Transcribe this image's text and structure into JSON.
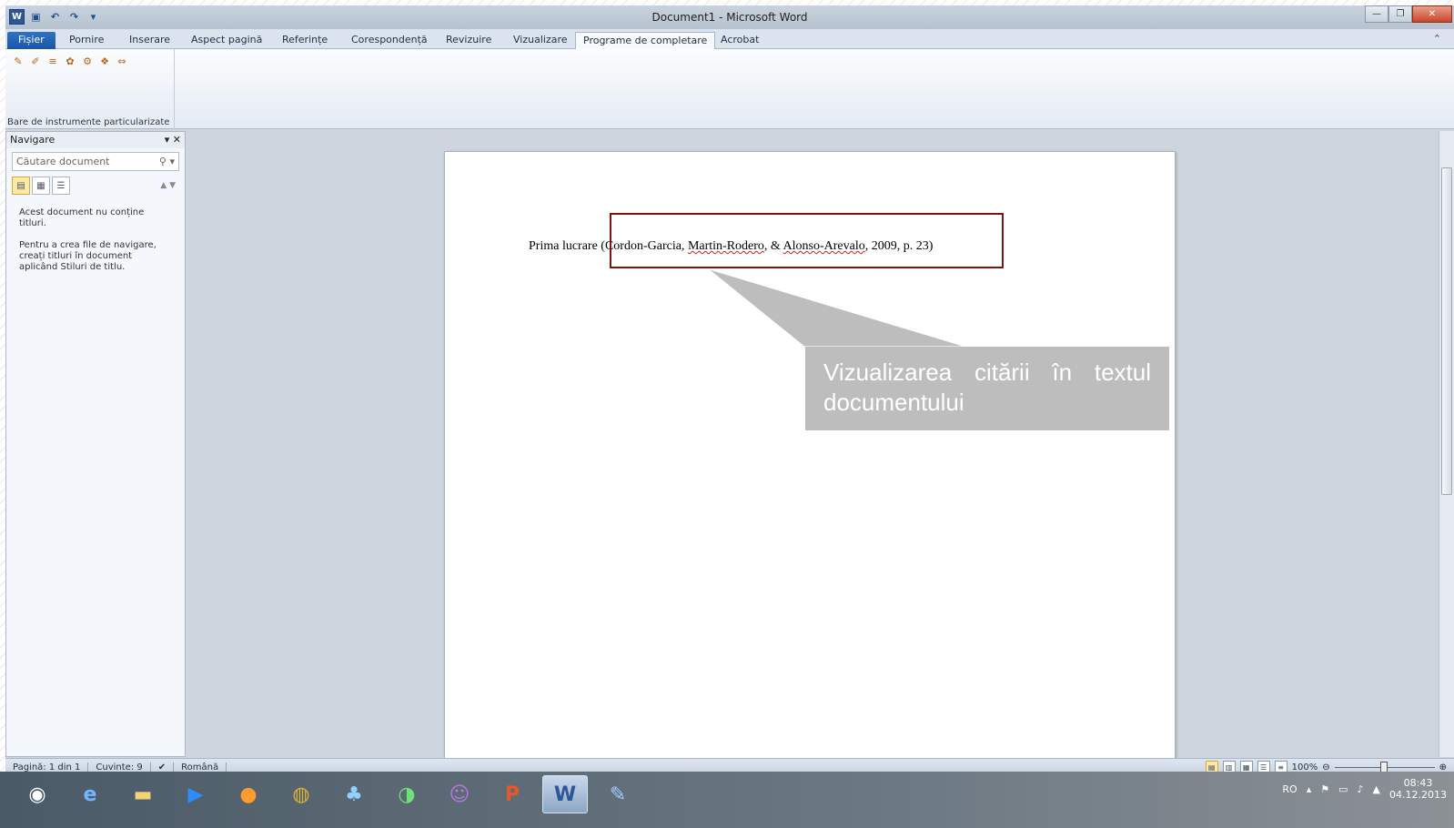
{
  "window": {
    "title": "Document1 - Microsoft Word"
  },
  "qat": {
    "word_icon": "word-icon",
    "save_icon": "save-icon",
    "undo_icon": "undo-icon",
    "redo_icon": "redo-icon"
  },
  "tabs": [
    {
      "label": "Fișier"
    },
    {
      "label": "Pornire"
    },
    {
      "label": "Inserare"
    },
    {
      "label": "Aspect pagină"
    },
    {
      "label": "Referințe"
    },
    {
      "label": "Corespondență"
    },
    {
      "label": "Revizuire"
    },
    {
      "label": "Vizualizare"
    },
    {
      "label": "Programe de completare"
    },
    {
      "label": "Acrobat"
    }
  ],
  "ribbon": {
    "group_label": "Bare de instrumente particularizate"
  },
  "nav": {
    "title": "Navigare",
    "search_placeholder": "Căutare document",
    "msg1": "Acest document nu conține titluri.",
    "msg2": "Pentru a crea file de navigare, creați titluri în document aplicând Stiluri de titlu."
  },
  "document": {
    "prefix": "Prima lucrare ",
    "cite_open": "(Cordon-Garcia, ",
    "author2": "Martin-Rodero",
    "mid": ", & ",
    "author3": "Alonso-Arevalo",
    "cite_close": ", 2009, p. 23)"
  },
  "callout": {
    "text": "Vizualizarea citării în textul documentului"
  },
  "status": {
    "page": "Pagină: 1 din 1",
    "words": "Cuvinte: 9",
    "language": "Română",
    "zoom": "100%"
  },
  "tray": {
    "lang": "RO",
    "time": "08:43",
    "date": "04.12.2013"
  },
  "colors": {
    "red_box": "#7d1414",
    "callout_bg": "#bdbdbd",
    "file_tab": "#1c56a3"
  }
}
